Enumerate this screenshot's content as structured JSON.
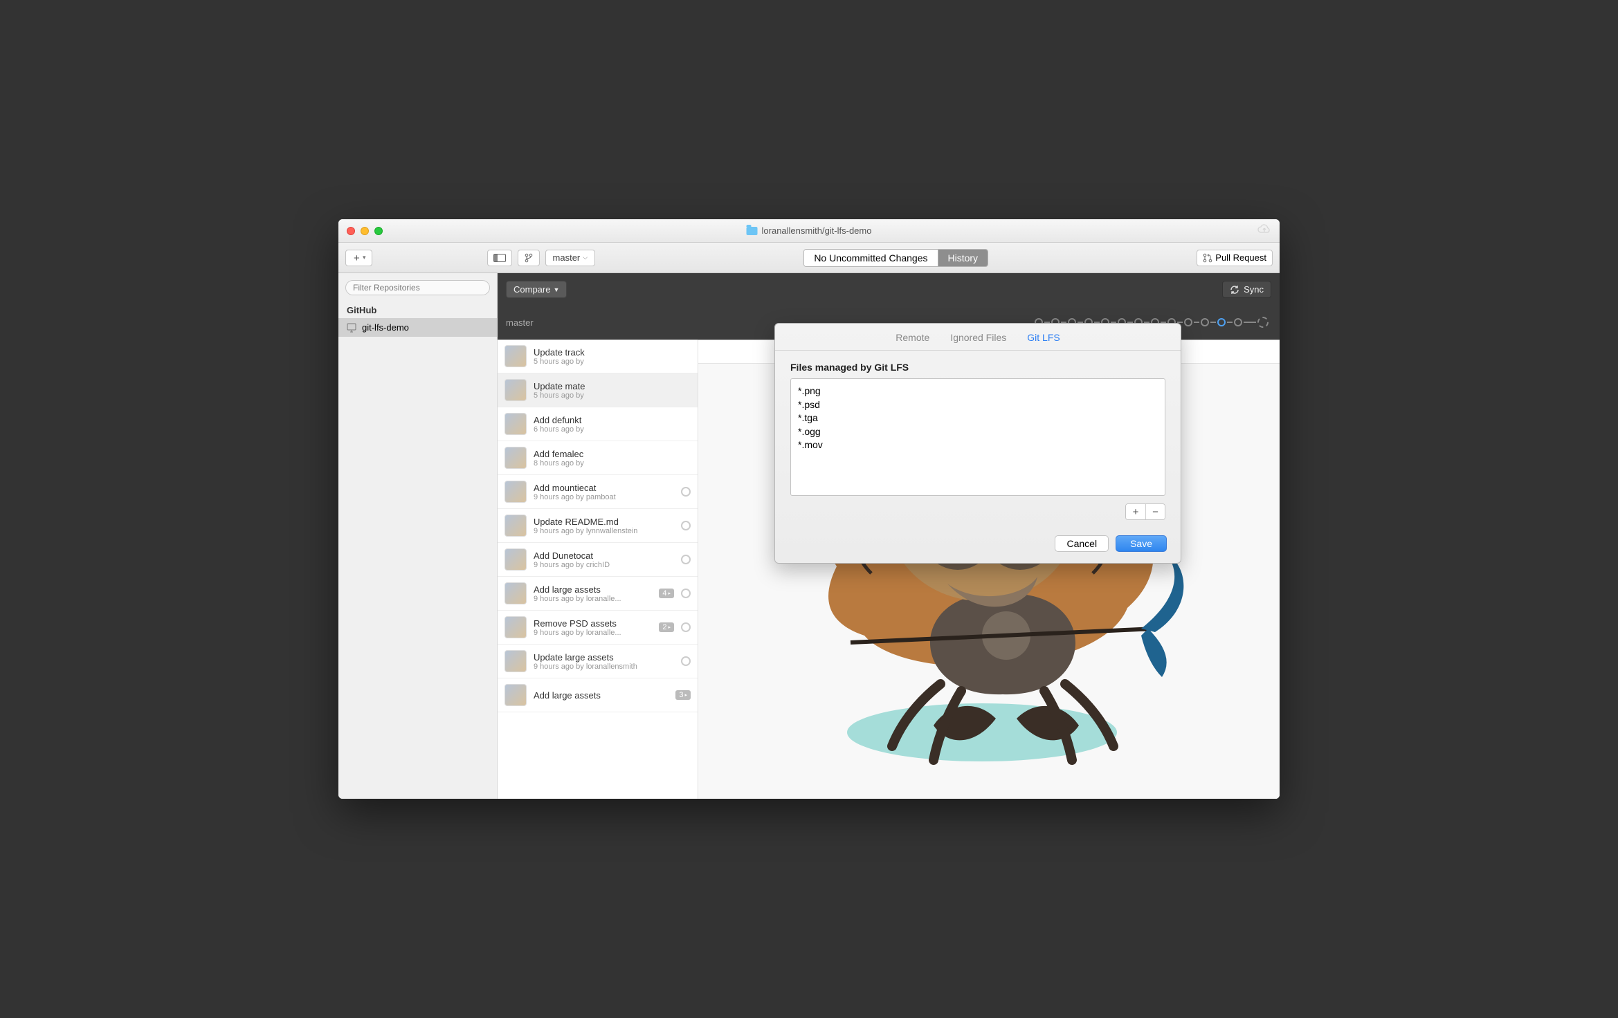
{
  "titlebar": {
    "title": "loranallensmith/git-lfs-demo"
  },
  "toolbar": {
    "branch": "master",
    "seg_uncommitted": "No Uncommitted Changes",
    "seg_history": "History",
    "pull_request": "Pull Request"
  },
  "sidebar": {
    "filter_placeholder": "Filter Repositories",
    "group": "GitHub",
    "repo": "git-lfs-demo"
  },
  "dark": {
    "compare": "Compare",
    "sync": "Sync",
    "branch_label": "master"
  },
  "commits": [
    {
      "title": "Update track",
      "meta": "5 hours ago by",
      "selected": false
    },
    {
      "title": "Update mate",
      "meta": "5 hours ago by",
      "selected": true
    },
    {
      "title": "Add defunkt",
      "meta": "6 hours ago by",
      "selected": false
    },
    {
      "title": "Add femalec",
      "meta": "8 hours ago by",
      "selected": false
    },
    {
      "title": "Add mountiecat",
      "meta": "9 hours ago by pamboat",
      "selected": false,
      "circle": true
    },
    {
      "title": "Update README.md",
      "meta": "9 hours ago by lynnwallenstein",
      "selected": false,
      "circle": true
    },
    {
      "title": "Add Dunetocat",
      "meta": "9 hours ago by crichID",
      "selected": false,
      "circle": true
    },
    {
      "title": "Add large assets",
      "meta": "9 hours ago by loranalle...",
      "selected": false,
      "circle": true,
      "badge": "4"
    },
    {
      "title": "Remove PSD assets",
      "meta": "9 hours ago by loranalle...",
      "selected": false,
      "circle": true,
      "badge": "2"
    },
    {
      "title": "Update large assets",
      "meta": "9 hours ago by loranallensmith",
      "selected": false,
      "circle": true
    },
    {
      "title": "Add large assets",
      "meta": "",
      "selected": false,
      "badge": "3"
    }
  ],
  "popover": {
    "tabs": {
      "remote": "Remote",
      "ignored": "Ignored Files",
      "lfs": "Git LFS"
    },
    "label": "Files managed by Git LFS",
    "patterns": "*.png\n*.psd\n*.tga\n*.ogg\n*.mov",
    "cancel": "Cancel",
    "save": "Save"
  }
}
